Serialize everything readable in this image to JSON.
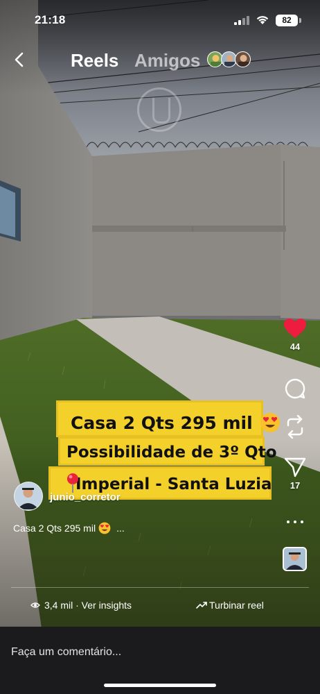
{
  "status_bar": {
    "time": "21:18",
    "battery": "82"
  },
  "nav": {
    "back_icon": "chevron-left-icon",
    "tab_reels": "Reels",
    "tab_amigos": "Amigos"
  },
  "sticker": {
    "line1": "Casa 2 Qts 295 mil",
    "line1_emoji": "heart-eyes-emoji",
    "line2": "Possibilidade de 3º Qto",
    "line3": "Imperial - Santa Luzia",
    "line3_icon": "pin-icon",
    "color": "#f4d02b"
  },
  "author": {
    "username": "junio_corretor"
  },
  "caption": {
    "text": "Casa 2 Qts 295 mil",
    "more": "..."
  },
  "actions": {
    "like_count": "44",
    "share_count": "17",
    "like_color": "#ee1d3f"
  },
  "stats": {
    "views_insights": "3,4 mil · Ver insights",
    "boost": "Turbinar reel"
  },
  "comment": {
    "placeholder": "Faça um comentário..."
  }
}
